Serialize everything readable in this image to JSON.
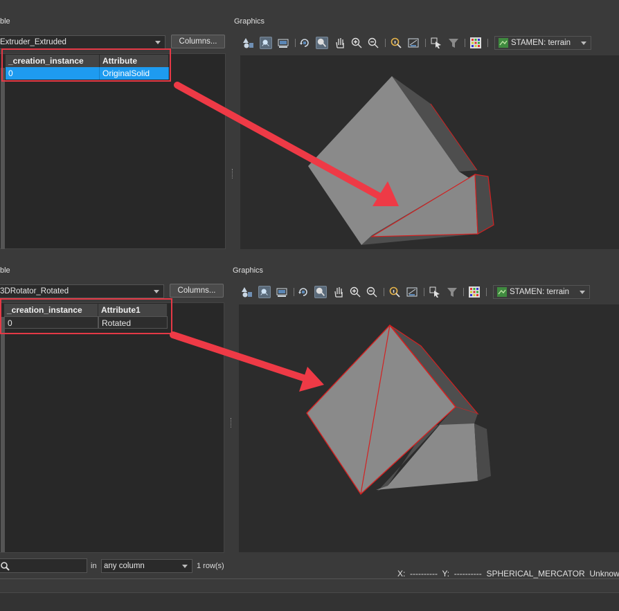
{
  "top": {
    "table_title": "ble",
    "graphics_title": "Graphics",
    "dataset": "Extruder_Extruded",
    "columns_button": "Columns...",
    "columns": [
      "_creation_instance",
      "Attribute"
    ],
    "row": [
      "0",
      "OriginalSolid"
    ],
    "basemap": "STAMEN: terrain"
  },
  "bottom": {
    "table_title": "ble",
    "graphics_title": "Graphics",
    "dataset": "3DRotator_Rotated",
    "columns_button": "Columns...",
    "columns": [
      "_creation_instance",
      "Attribute1"
    ],
    "row": [
      "0",
      "Rotated"
    ],
    "basemap": "STAMEN: terrain"
  },
  "search": {
    "placeholder": "",
    "in_label": "in",
    "column_select": "any column",
    "row_count": "1 row(s)"
  },
  "status": {
    "x_label": "X:",
    "x_value": "----------",
    "y_label": "Y:",
    "y_value": "----------",
    "projection": "SPHERICAL_MERCATOR",
    "units": "Unknown"
  },
  "toolbar_icons": [
    "shapes-icon",
    "pan-view-icon",
    "screen-icon",
    "rotate-icon",
    "inspect-icon",
    "hand-icon",
    "zoom-in-icon",
    "zoom-out-icon",
    "info-icon",
    "measure-icon",
    "select-icon",
    "filter-icon",
    "grid-icon"
  ],
  "colors": {
    "accent": "#1e9bf0",
    "highlight": "#e53946",
    "shape": "#8c8c8c"
  }
}
